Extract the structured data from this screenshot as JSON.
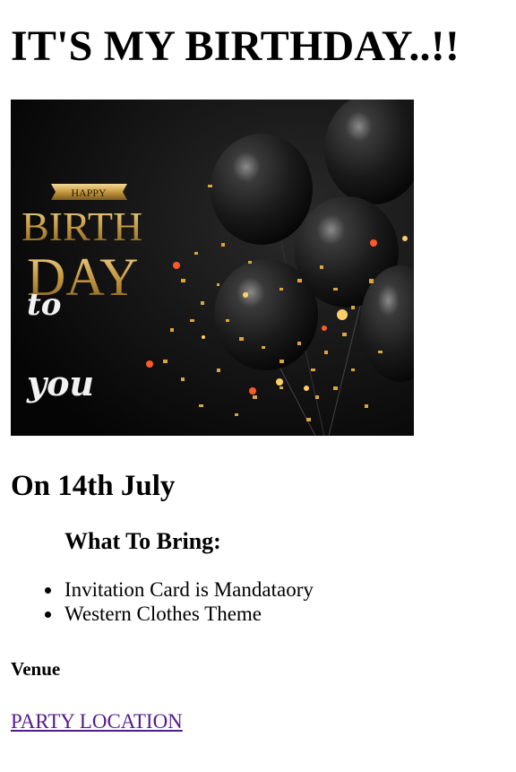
{
  "page": {
    "title": "IT'S MY BIRTHDAY..!!",
    "date_heading": "On 14th July",
    "bring": {
      "heading": "What To Bring:",
      "items": [
        "Invitation Card is Mandataory",
        "Western Clothes Theme"
      ]
    },
    "venue_heading": "Venue",
    "location_link": "PARTY LOCATION"
  },
  "banner_image": {
    "alt": "Happy Birthday to you",
    "text_happy": "HAPPY",
    "text_birth": "BIRTH",
    "text_day": "DAY",
    "text_to": "to",
    "text_you": "you"
  },
  "colors": {
    "link_visited": "#551a8b",
    "banner_bg": "#0a0a0a",
    "gold": "#c9a24a",
    "balloon": "#1e1e1e"
  }
}
